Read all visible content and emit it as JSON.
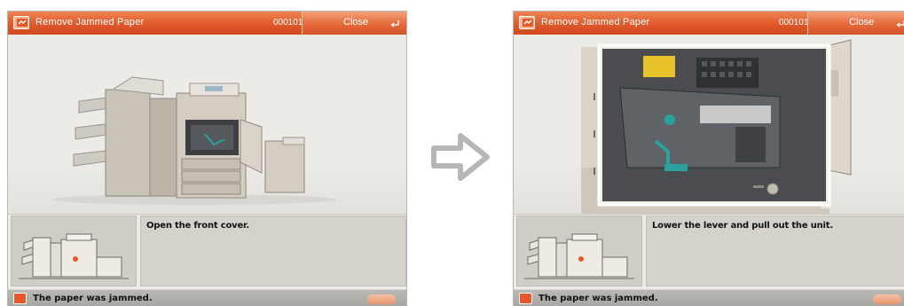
{
  "screens": [
    {
      "title": "Remove Jammed Paper",
      "code": "000101",
      "close_label": "Close",
      "instruction": "Open the front cover.",
      "status": "The paper was jammed."
    },
    {
      "title": "Remove Jammed Paper",
      "code": "000101",
      "close_label": "Close",
      "instruction": "Lower the lever and pull out the unit.",
      "status": "The paper was jammed."
    }
  ],
  "colors": {
    "title_bar": "#e0582a",
    "panel_bg": "#ecebe7",
    "status_bar": "#b0afa9"
  },
  "icons": {
    "title_icon": "paper-jam-icon",
    "next_step": "arrow-right-outline-icon"
  }
}
